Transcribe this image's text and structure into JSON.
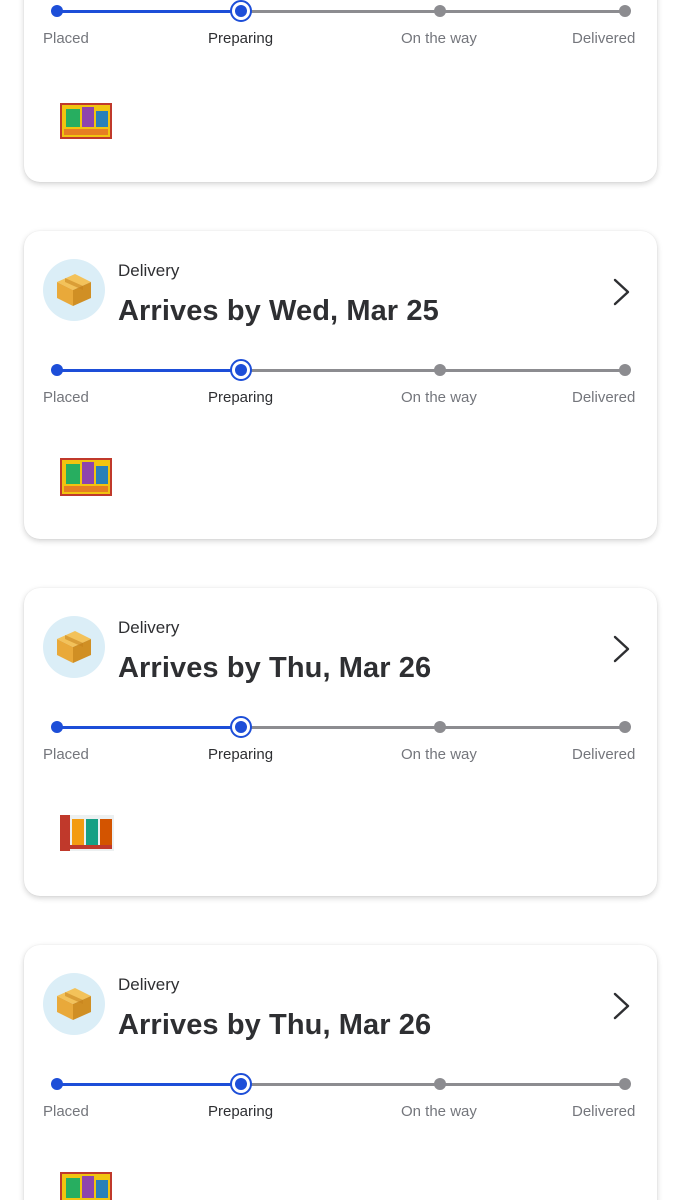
{
  "colors": {
    "accent": "#1d4ed8",
    "inactive": "#8c8c90",
    "icon_bg": "#dbeef7",
    "box": "#e9a93a"
  },
  "steps": {
    "placed": "Placed",
    "preparing": "Preparing",
    "on_the_way": "On the way",
    "delivered": "Delivered"
  },
  "cards": [
    {
      "delivery_label": "",
      "arrives": "",
      "current_step": "Preparing",
      "progress_fraction": 0.3333
    },
    {
      "delivery_label": "Delivery",
      "arrives": "Arrives by Wed, Mar 25",
      "current_step": "Preparing",
      "progress_fraction": 0.3333
    },
    {
      "delivery_label": "Delivery",
      "arrives": "Arrives by Thu, Mar 26",
      "current_step": "Preparing",
      "progress_fraction": 0.3333
    },
    {
      "delivery_label": "Delivery",
      "arrives": "Arrives by Thu, Mar 26",
      "current_step": "Preparing",
      "progress_fraction": 0.3333
    }
  ],
  "icons": {
    "package": "package-box-icon",
    "chevron": "chevron-right-icon",
    "product": "product-thumbnail"
  }
}
